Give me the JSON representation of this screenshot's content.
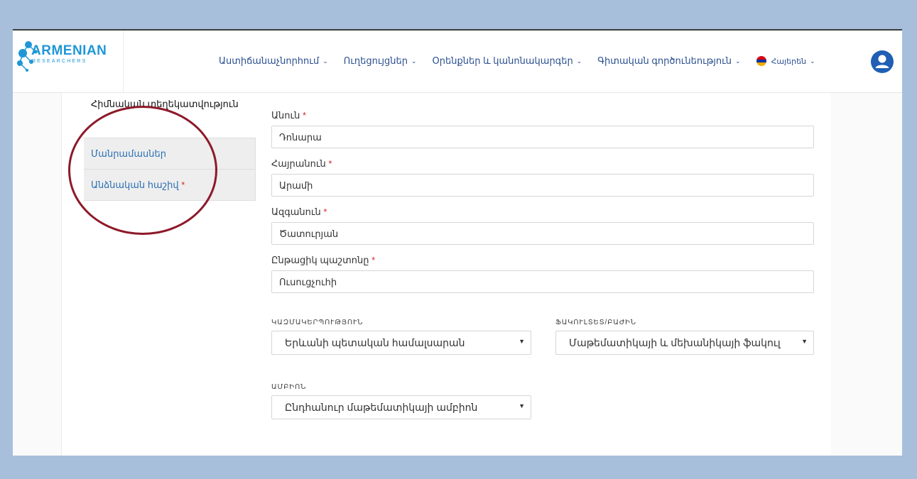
{
  "logo": {
    "title": "ARMENIAN",
    "subtitle": "RESEARCHERS"
  },
  "nav": {
    "items": [
      {
        "label": "Աստիճանաչնորհում"
      },
      {
        "label": "Ուղեցույցներ"
      },
      {
        "label": "Օրենքներ և կանոնակարգեր"
      },
      {
        "label": "Գիտական գործունեություն"
      }
    ],
    "language": "Հայերեն"
  },
  "tabs": [
    {
      "label": "Հիմնական տեղեկատվություն",
      "active": true
    },
    {
      "label": "Մանրամասներ",
      "active": false
    },
    {
      "label": "Անձնական հաշիվ",
      "required_mark": "*",
      "active": false
    }
  ],
  "form": {
    "first_name": {
      "label": "Անուն",
      "required_mark": "*",
      "value": "Դոնարա"
    },
    "last_name": {
      "label": "Հայրանուն",
      "required_mark": "*",
      "value": "Արամի"
    },
    "surname": {
      "label": "Ազգանուն",
      "required_mark": "*",
      "value": "Ծատուրյան"
    },
    "position": {
      "label": "Ընթացիկ պաշտոնը",
      "required_mark": "*",
      "value": "Ուսուցչուհի"
    },
    "organization": {
      "label": "ԿԱԶՄԱԿԵՐՊՈՒԹՅՈՒՆ",
      "value": "Երևանի պետական համալսարան"
    },
    "faculty": {
      "label": "ՖԱԿՈՒԼՏԵՏ/ԲԱԺԻՆ",
      "value": "Մաթեմատիկայի և մեխանիկայի ֆակուլ"
    },
    "chair": {
      "label": "ԱՄԲԻՈՆ",
      "value": "Ընդհանուր մաթեմատիկայի ամբիոն"
    }
  },
  "colors": {
    "accent": "#1f97d6",
    "nav_text": "#2a4f8f",
    "required": "#d9232d",
    "highlight_circle": "#8d1a2a"
  }
}
